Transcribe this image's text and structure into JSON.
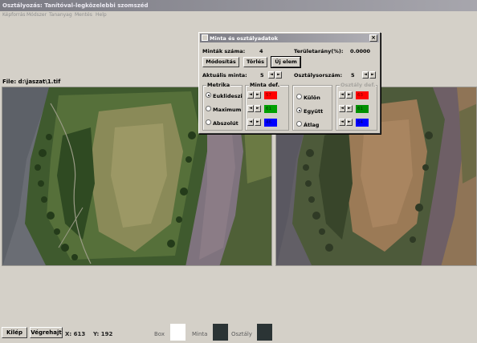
{
  "window": {
    "title": "Osztályozás: Tanítóval-legközelebbi szomszéd"
  },
  "menu": [
    "Képforrás",
    "Módszer",
    "Tananyag",
    "Mentés",
    "Help"
  ],
  "file_label": "File: d:\\jaszat\\1.tif",
  "dialog": {
    "title": "Minta és osztályadatok",
    "close": "×",
    "sample_count_label": "Minták száma:",
    "sample_count_value": "4",
    "area_ratio_label": "Területarány(%):",
    "area_ratio_value": "0.0000",
    "buttons": {
      "modify": "Módosítás",
      "delete": "Törlés",
      "new": "Új elem"
    },
    "current_sample_label": "Aktuális minta:",
    "current_sample_value": "5",
    "class_number_label": "Osztálysorszám:",
    "class_number_value": "5",
    "arrow_left": "◄",
    "arrow_right": "►",
    "metric": {
      "title": "Metrika",
      "options": [
        "Euklideszi",
        "Maximum",
        "Abszolút"
      ],
      "selected": "Euklideszi"
    },
    "sample_def": {
      "title": "Minta def.",
      "channels": [
        {
          "value": "57",
          "color": "#ff0000",
          "text_color": "#7a0000"
        },
        {
          "value": "61",
          "color": "#00a000",
          "text_color": "#003500"
        },
        {
          "value": "46",
          "color": "#0000ff",
          "text_color": "#000070"
        }
      ]
    },
    "mode": {
      "options": [
        "Külön",
        "Együtt",
        "Átlag"
      ],
      "selected": "Együtt"
    },
    "class_def": {
      "title": "Osztály def.",
      "channels": [
        {
          "value": "63",
          "color": "#ff0000",
          "text_color": "#7a0000"
        },
        {
          "value": "61",
          "color": "#009000",
          "text_color": "#003500"
        },
        {
          "value": "54",
          "color": "#0000ff",
          "text_color": "#000070"
        }
      ]
    }
  },
  "bottom": {
    "exit_button": "Kilép",
    "run_button": "Végrehajt",
    "x_coord": "X: 613",
    "y_coord": "Y: 192",
    "box_label": "Box",
    "box_color": "#ffffff",
    "sample_label": "Minta",
    "sample_color": "#2b3435",
    "class_label": "Osztály",
    "class_color": "#2b3435"
  }
}
